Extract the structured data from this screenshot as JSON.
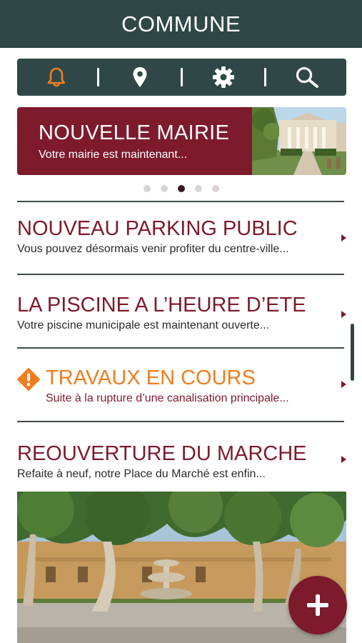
{
  "app": {
    "title": "COMMUNE"
  },
  "toolbar": {
    "icons": [
      "bell-icon",
      "map-pin-icon",
      "gear-icon",
      "search-icon"
    ],
    "active_color": "#f07d1e"
  },
  "carousel": {
    "title": "NOUVELLE MAIRIE",
    "subtitle": "Votre mairie est maintenant...",
    "slide_count": 5,
    "active_index": 2
  },
  "news": [
    {
      "title": "NOUVEAU PARKING PUBLIC",
      "subtitle": "Vous pouvez désormais venir profiter du centre-ville..."
    },
    {
      "title": "LA PISCINE A L’HEURE D’ETE",
      "subtitle": "Votre piscine municipale est maintenant ouverte..."
    },
    {
      "title": "TRAVAUX EN COURS",
      "subtitle": "Suite à la rupture d’une canalisation principale...",
      "alert": true
    },
    {
      "title": "REOUVERTURE DU MARCHE",
      "subtitle": "Refaite à neuf, notre Place du Marché est enfin..."
    }
  ],
  "colors": {
    "primary": "#2f4747",
    "accent": "#7d1a2c",
    "warning": "#f07d1e"
  }
}
